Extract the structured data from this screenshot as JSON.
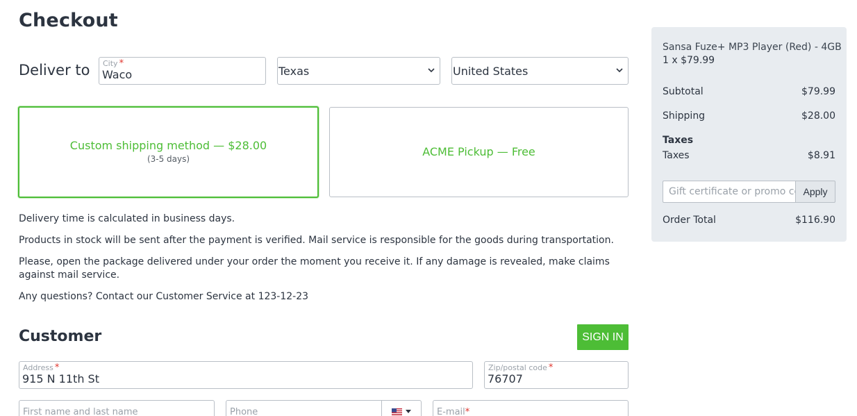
{
  "page": {
    "title": "Checkout"
  },
  "delivery": {
    "label": "Deliver to",
    "city": {
      "label": "City",
      "required": "*",
      "value": "Waco"
    },
    "state": {
      "value": "Texas"
    },
    "country": {
      "value": "United States"
    }
  },
  "shipping": {
    "options": [
      {
        "name": "Custom shipping method — $28.00",
        "days": "(3-5 days)",
        "selected": true
      },
      {
        "name": "ACME Pickup — Free",
        "selected": false
      }
    ]
  },
  "info": [
    "Delivery time is calculated in business days.",
    "Products in stock will be sent after the payment is verified. Mail service is responsible for the goods during transportation.",
    "Please, open the package delivered under your order the moment you receive it. If any damage is revealed, make claims against mail service.",
    "Any questions? Contact our Customer Service at 123-12-23"
  ],
  "customer": {
    "title": "Customer",
    "sign_in": "SIGN IN",
    "address": {
      "label": "Address",
      "required": "*",
      "value": "915 N 11th St"
    },
    "zip": {
      "label": "Zip/postal code",
      "required": "*",
      "value": "76707"
    },
    "name": {
      "placeholder": "First name and last name"
    },
    "phone": {
      "placeholder": "Phone",
      "flag_icon": "us-flag-icon"
    },
    "email": {
      "label": "E-mail",
      "required": "*"
    }
  },
  "summary": {
    "item_name": "Sansa Fuze+ MP3 Player (Red) - 4GB",
    "item_qty": "1 x $79.99",
    "subtotal_label": "Subtotal",
    "subtotal_value": "$79.99",
    "shipping_label": "Shipping",
    "shipping_value": "$28.00",
    "taxes_heading": "Taxes",
    "taxes_label": "Taxes",
    "taxes_value": "$8.91",
    "promo_placeholder": "Gift certificate or promo code",
    "apply_label": "Apply",
    "total_label": "Order Total",
    "total_value": "$116.90"
  },
  "colors": {
    "accent": "#4dbd36",
    "text": "#2c3440",
    "sidebar_bg": "#e8ecf0",
    "required": "#e0342c"
  }
}
